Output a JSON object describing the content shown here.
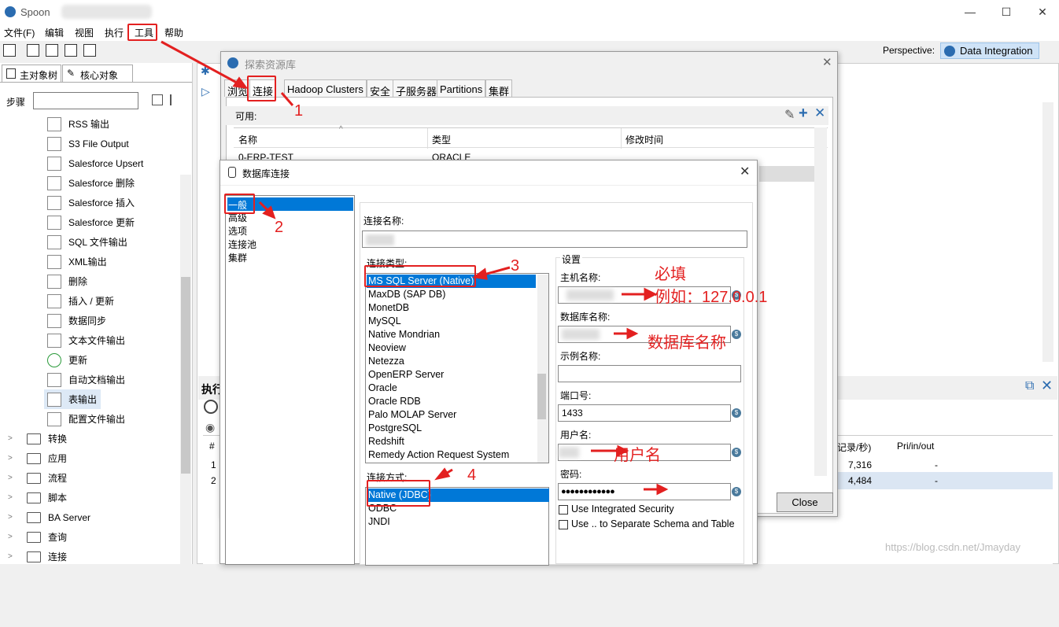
{
  "window": {
    "title": "Spoon",
    "minimize": "—",
    "maximize": "☐",
    "close": "✕"
  },
  "menu": [
    "文件(F)",
    "编辑",
    "视图",
    "执行",
    "工具",
    "帮助"
  ],
  "perspective": {
    "label": "Perspective:",
    "value": "Data Integration"
  },
  "left_tabs": [
    "主对象树",
    "核心对象"
  ],
  "steps": {
    "label": "步骤"
  },
  "tree_items": [
    "RSS 输出",
    "S3 File Output",
    "Salesforce Upsert",
    "Salesforce 删除",
    "Salesforce 插入",
    "Salesforce 更新",
    "SQL 文件输出",
    "XML输出",
    "删除",
    "插入 / 更新",
    "数据同步",
    "文本文件输出",
    "更新",
    "自动文档输出",
    "表输出",
    "配置文件输出"
  ],
  "tree_folders": [
    "转换",
    "应用",
    "流程",
    "脚本",
    "BA Server",
    "查询",
    "连接"
  ],
  "explorer": {
    "title": "探索资源库",
    "tabs": [
      "浏览",
      "连接",
      "Hadoop Clusters",
      "安全",
      "子服务器",
      "Partitions",
      "集群"
    ],
    "available_label": "可用:",
    "columns": [
      "名称",
      "类型",
      "修改时间"
    ],
    "row0": {
      "name": "0-ERP-TEST",
      "type": "ORACLE"
    },
    "close_label": "Close"
  },
  "exec": {
    "label": "执行",
    "col_speed": "记录/秒)",
    "col_pri": "Pri/in/out",
    "rows": [
      {
        "n": "1",
        "speed": "7,316",
        "pri": "-"
      },
      {
        "n": "2",
        "speed": "4,484",
        "pri": "-"
      }
    ],
    "hash": "#"
  },
  "db_dialog": {
    "title": "数据库连接",
    "categories": [
      "一般",
      "高级",
      "选项",
      "连接池",
      "集群"
    ],
    "conn_name_label": "连接名称:",
    "conn_type_label": "连接类型:",
    "conn_types": [
      "MS SQL Server (Native)",
      "MaxDB (SAP DB)",
      "MonetDB",
      "MySQL",
      "Native Mondrian",
      "Neoview",
      "Netezza",
      "OpenERP Server",
      "Oracle",
      "Oracle RDB",
      "Palo MOLAP Server",
      "PostgreSQL",
      "Redshift",
      "Remedy Action Request System"
    ],
    "access_label": "连接方式:",
    "access_types": [
      "Native (JDBC)",
      "ODBC",
      "JNDI"
    ],
    "settings_label": "设置",
    "host_label": "主机名称:",
    "dbname_label": "数据库名称:",
    "instance_label": "示例名称:",
    "port_label": "端口号:",
    "port_value": "1433",
    "user_label": "用户名:",
    "password_label": "密码:",
    "password_value": "●●●●●●●●●●●●",
    "cb_integrated": "Use Integrated Security",
    "cb_schema": "Use .. to Separate Schema and Table"
  },
  "annotations": {
    "n1": "1",
    "n2": "2",
    "n3": "3",
    "n4": "4",
    "required": "必填",
    "example": "例如：127.0.0.1",
    "dbname": "数据库名称",
    "username": "用户名"
  },
  "watermark": "https://blog.csdn.net/Jmayday",
  "colors": {
    "accent": "#0078d7",
    "annotation": "#e32020"
  }
}
